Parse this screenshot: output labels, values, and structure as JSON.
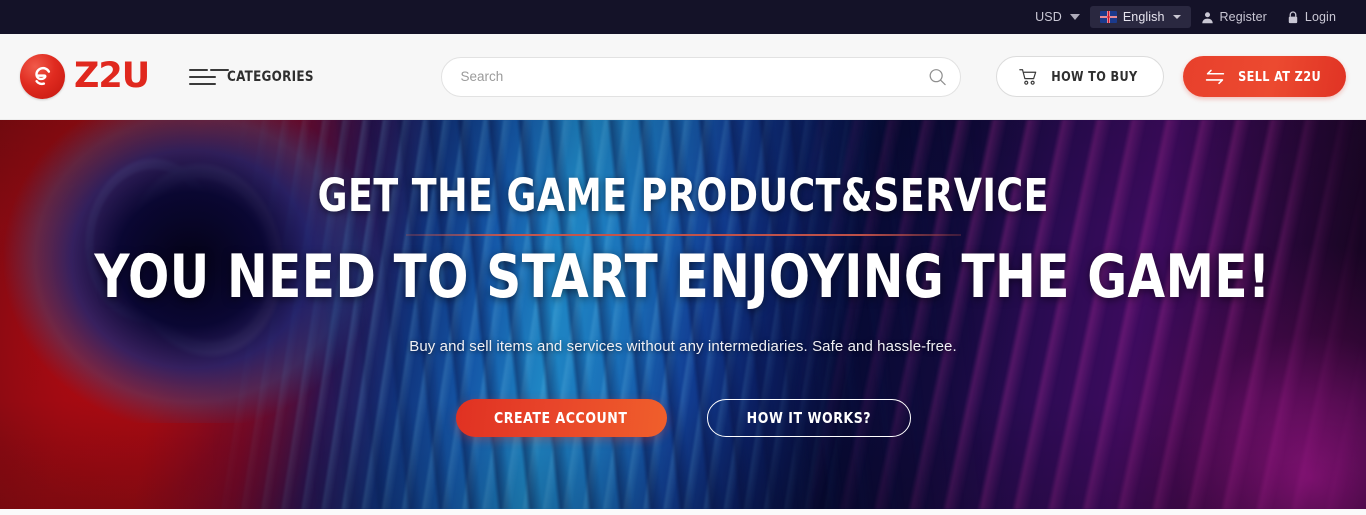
{
  "topbar": {
    "currency": {
      "label": "USD",
      "icon": "chevron-down-icon"
    },
    "language": {
      "label": "English",
      "icon": "uk-flag-icon",
      "caret": "chevron-down-icon"
    },
    "register": {
      "label": "Register",
      "icon": "user-icon"
    },
    "login": {
      "label": "Login",
      "icon": "lock-icon"
    }
  },
  "header": {
    "logo": {
      "text": "Z2U",
      "mark_icon": "z2u-logo-icon",
      "color": "#e0281e"
    },
    "categories": {
      "label": "CATEGORIES",
      "icon": "hamburger-icon"
    },
    "search": {
      "value": "",
      "placeholder": "Search",
      "icon": "search-icon"
    },
    "how_to_buy": {
      "label": "HOW TO BUY",
      "icon": "shopping-cart-icon"
    },
    "sell": {
      "label": "SELL AT Z2U",
      "icon": "exchange-arrows-icon",
      "color": "#e8402c"
    }
  },
  "hero": {
    "headline_line1": "GET THE GAME PRODUCT&SERVICE",
    "headline_line2": "YOU NEED TO START ENJOYING THE GAME!",
    "subtitle": "Buy and sell items and services without any intermediaries. Safe and hassle-free.",
    "cta_primary": "CREATE ACCOUNT",
    "cta_secondary": "HOW IT WORKS?",
    "accent_color": "#e03122",
    "divider_color": "#c4564e"
  }
}
